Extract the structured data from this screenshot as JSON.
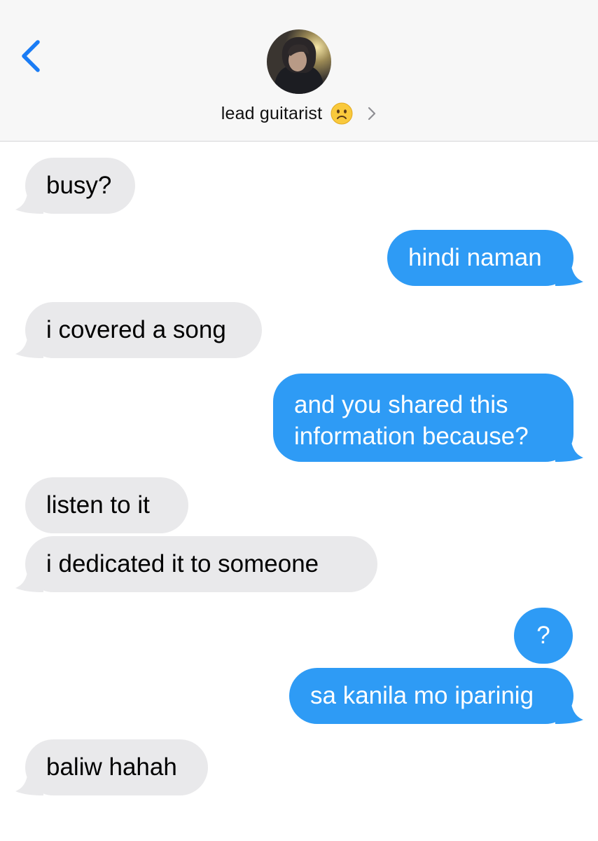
{
  "header": {
    "contact_name": "lead guitarist",
    "status_emoji_icon": "slightly-frowning-face-icon",
    "back_icon": "chevron-left-icon",
    "details_icon": "chevron-right-icon"
  },
  "colors": {
    "incoming_bubble": "#e9e9eb",
    "outgoing_bubble": "#2e9bf5",
    "accent": "#1a7cf5"
  },
  "messages": [
    {
      "direction": "incoming",
      "text": "busy?"
    },
    {
      "direction": "outgoing",
      "text": "hindi naman"
    },
    {
      "direction": "incoming",
      "text": "i covered a song"
    },
    {
      "direction": "outgoing",
      "lines": [
        "and you shared this",
        "information because?"
      ]
    },
    {
      "direction": "incoming",
      "text": "listen to it"
    },
    {
      "direction": "incoming",
      "text": "i dedicated it to someone"
    },
    {
      "direction": "outgoing",
      "text": "?"
    },
    {
      "direction": "outgoing",
      "text": "sa kanila mo iparinig"
    },
    {
      "direction": "incoming",
      "text": "baliw hahah"
    }
  ]
}
